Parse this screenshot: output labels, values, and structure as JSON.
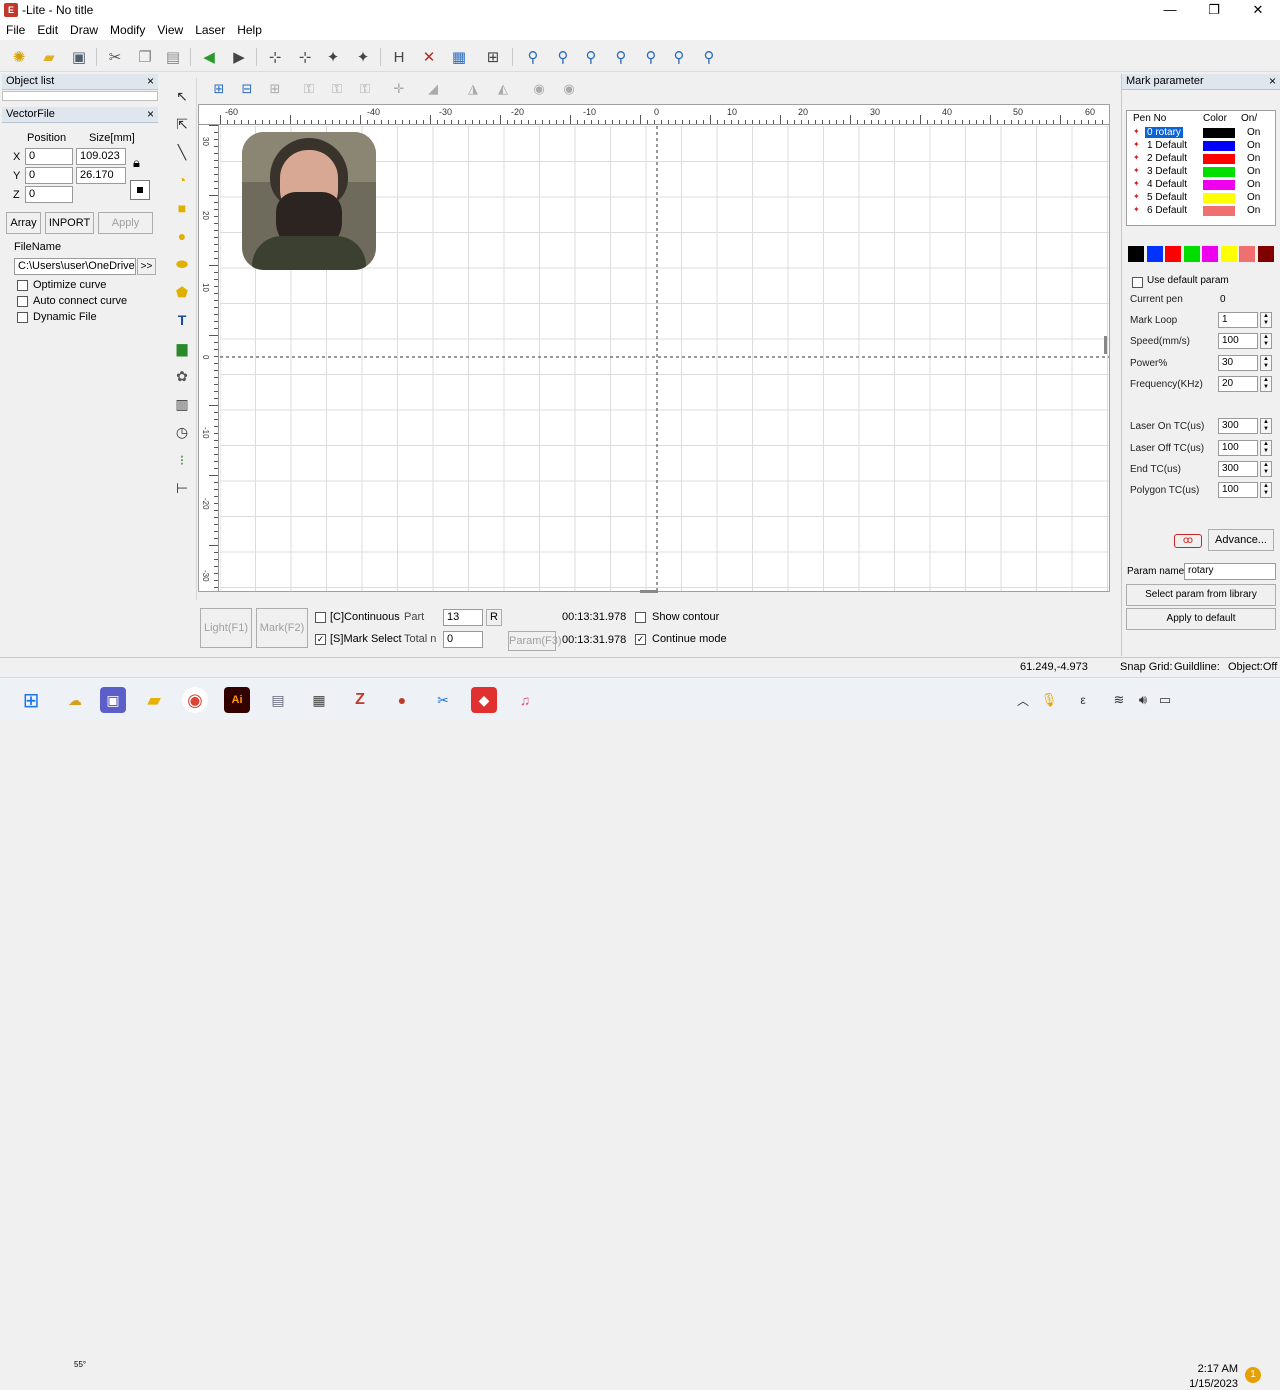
{
  "window": {
    "title": "-Lite - No title",
    "minimize": "—",
    "maximize": "❐",
    "close": "✕"
  },
  "menu": [
    "File",
    "Edit",
    "Draw",
    "Modify",
    "View",
    "Laser",
    "Help"
  ],
  "object_list": {
    "title": "Object list",
    "close": "×"
  },
  "vectorfile": {
    "title": "VectorFile",
    "close": "×",
    "position_header": "Position",
    "size_header": "Size[mm]",
    "x_label": "X",
    "y_label": "Y",
    "z_label": "Z",
    "x_pos": "0",
    "y_pos": "0",
    "z_pos": "0",
    "width": "109.023",
    "height": "26.170",
    "array_button": "Array",
    "inport_button": "INPORT",
    "apply_button": "Apply",
    "filename_label": "FileName",
    "filename_value": "C:\\Users\\user\\OneDrive\\",
    "browse_button": ">>",
    "optimize_curve": "Optimize curve",
    "auto_connect": "Auto connect curve",
    "dynamic_file": "Dynamic File"
  },
  "rulers": {
    "h_labels": [
      "-60",
      "-40",
      "-30",
      "-20",
      "-10",
      "0",
      "10",
      "20",
      "30",
      "40",
      "50",
      "60"
    ],
    "v_labels": [
      "30",
      "20",
      "10",
      "0",
      "-10",
      "-20",
      "-30"
    ]
  },
  "mark_parameter": {
    "title": "Mark parameter",
    "close": "×",
    "col_pen": "Pen No",
    "col_color": "Color",
    "col_on": "On/",
    "pens": [
      {
        "name": "0 rotary",
        "color": "#000000",
        "on": "On"
      },
      {
        "name": "1 Default",
        "color": "#0000ff",
        "on": "On"
      },
      {
        "name": "2 Default",
        "color": "#ff0000",
        "on": "On"
      },
      {
        "name": "3 Default",
        "color": "#00e000",
        "on": "On"
      },
      {
        "name": "4 Default",
        "color": "#ee00ee",
        "on": "On"
      },
      {
        "name": "5 Default",
        "color": "#ffff00",
        "on": "On"
      },
      {
        "name": "6 Default",
        "color": "#f07070",
        "on": "On"
      }
    ],
    "palette": [
      "#000000",
      "#0033ff",
      "#ff0000",
      "#00dd00",
      "#ee00ee",
      "#ffff00",
      "#f07070",
      "#800000"
    ],
    "use_default": "Use default param",
    "current_pen_label": "Current pen",
    "current_pen_value": "0",
    "mark_loop_label": "Mark Loop",
    "mark_loop_value": "1",
    "speed_label": "Speed(mm/s)",
    "speed_value": "100",
    "power_label": "Power%",
    "power_value": "30",
    "freq_label": "Frequency(KHz)",
    "freq_value": "20",
    "laser_on_label": "Laser On TC(us)",
    "laser_on_value": "300",
    "laser_off_label": "Laser Off TC(us)",
    "laser_off_value": "100",
    "end_tc_label": "End TC(us)",
    "end_tc_value": "300",
    "polygon_label": "Polygon TC(us)",
    "polygon_value": "100",
    "advance_button": "Advance...",
    "param_name_label": "Param name",
    "param_name_value": "rotary",
    "select_lib_button": "Select param from library",
    "apply_default_button": "Apply to default"
  },
  "bottom": {
    "light_button": "Light(F1)",
    "mark_button": "Mark(F2)",
    "continuous": "[C]Continuous",
    "mark_select": "[S]Mark Select",
    "part_label": "Part",
    "part_value": "13",
    "r_button": "R",
    "total_label": "Total n",
    "total_value": "0",
    "param_button": "Param(F3)",
    "time1": "00:13:31.978",
    "time2": "00:13:31.978",
    "show_contour": "Show contour",
    "continue_mode": "Continue mode"
  },
  "status": {
    "coords": "61.249,-4.973",
    "snap_grid": "Snap Grid:",
    "guideline": "Guildline:",
    "object": "Object:Off"
  },
  "taskbar": {
    "weather": "55°",
    "time": "2:17 AM",
    "date": "1/15/2023",
    "notification_count": "1"
  }
}
